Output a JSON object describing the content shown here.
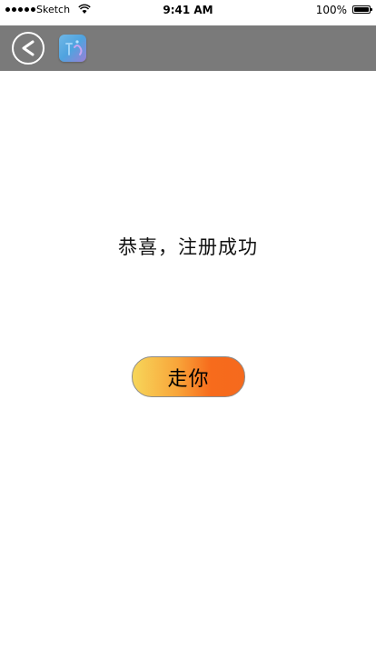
{
  "status_bar": {
    "carrier": "Sketch",
    "time": "9:41 AM",
    "battery_percent": "100%"
  },
  "nav": {
    "back_icon": "chevron-left-icon",
    "logo_icon": "app-logo-icon"
  },
  "main": {
    "message": "恭喜，注册成功",
    "go_button_label": "走你"
  },
  "colors": {
    "nav_background": "#7a7a7a",
    "button_gradient_start": "#f7d65a",
    "button_gradient_end": "#f56a1d"
  }
}
